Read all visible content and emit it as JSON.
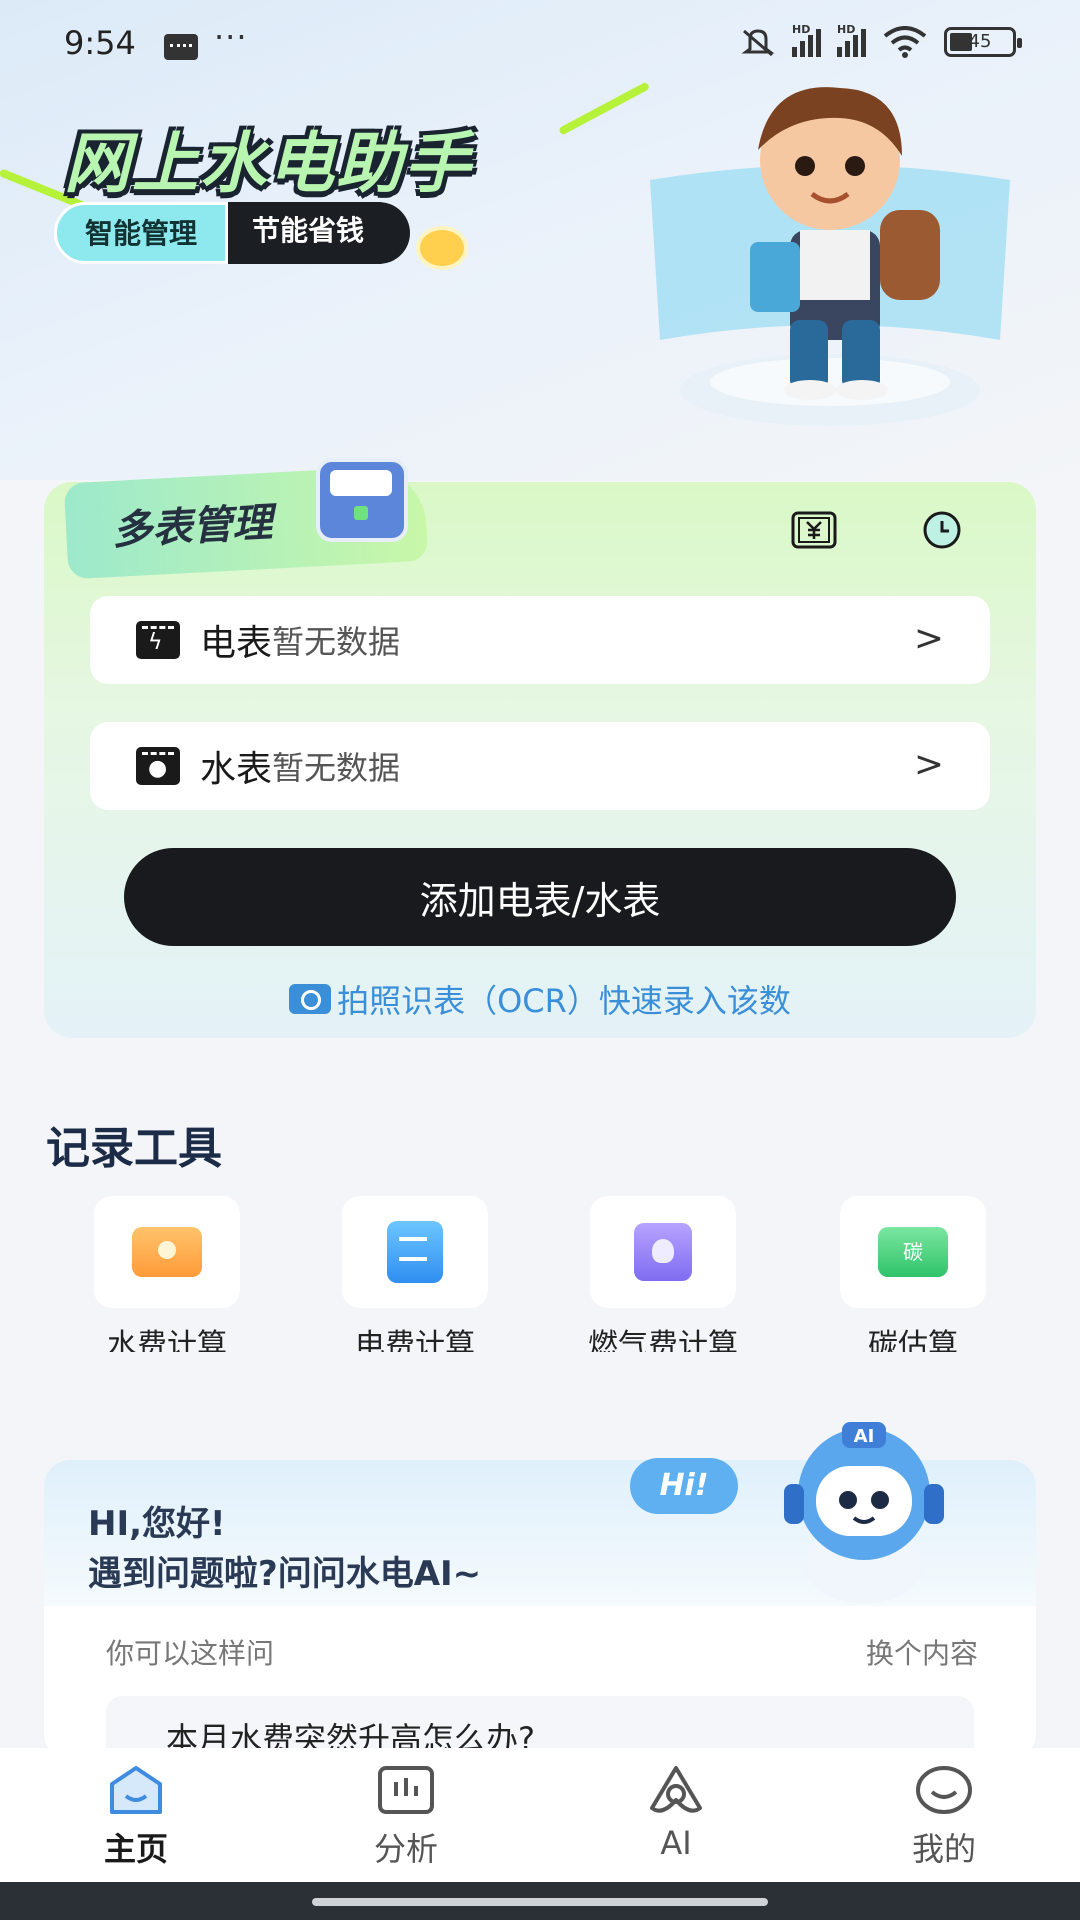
{
  "status_bar": {
    "time": "9:54",
    "battery": "45"
  },
  "banner": {
    "title": "网上水电助手",
    "tag_primary": "智能管理",
    "tag_secondary": "节能省钱"
  },
  "meter_card": {
    "header": "多表管理",
    "rows": [
      {
        "name": "电表",
        "status": "暂无数据",
        "icon": "electric-meter-icon"
      },
      {
        "name": "水表",
        "status": "暂无数据",
        "icon": "water-meter-icon"
      }
    ],
    "add_button": "添加电表/水表",
    "ocr_link": "拍照识表（OCR）快速录入该数"
  },
  "tools": {
    "title": "记录工具",
    "items": [
      {
        "label": "水费计算",
        "icon": "water-fee-icon"
      },
      {
        "label": "电费计算",
        "icon": "electricity-fee-icon"
      },
      {
        "label": "燃气费计算",
        "icon": "gas-fee-icon"
      },
      {
        "label": "碳估算",
        "icon": "carbon-icon",
        "icon_text": "碳"
      }
    ]
  },
  "ai_card": {
    "bubble": "Hi!",
    "greeting": "HI,您好!",
    "prompt": "遇到问题啦?问问水电AI~",
    "hint": "你可以这样问",
    "change": "换个内容",
    "question": "本月水费突然升高怎么办?"
  },
  "nav": {
    "items": [
      {
        "label": "主页",
        "icon": "home-icon",
        "active": true
      },
      {
        "label": "分析",
        "icon": "chart-icon",
        "active": false
      },
      {
        "label": "AI",
        "icon": "ai-icon",
        "active": false
      },
      {
        "label": "我的",
        "icon": "profile-icon",
        "active": false
      }
    ]
  },
  "colors": {
    "accent": "#3a8fd8",
    "primary_button": "#181a1d",
    "card_green": "#d9f8c6"
  }
}
